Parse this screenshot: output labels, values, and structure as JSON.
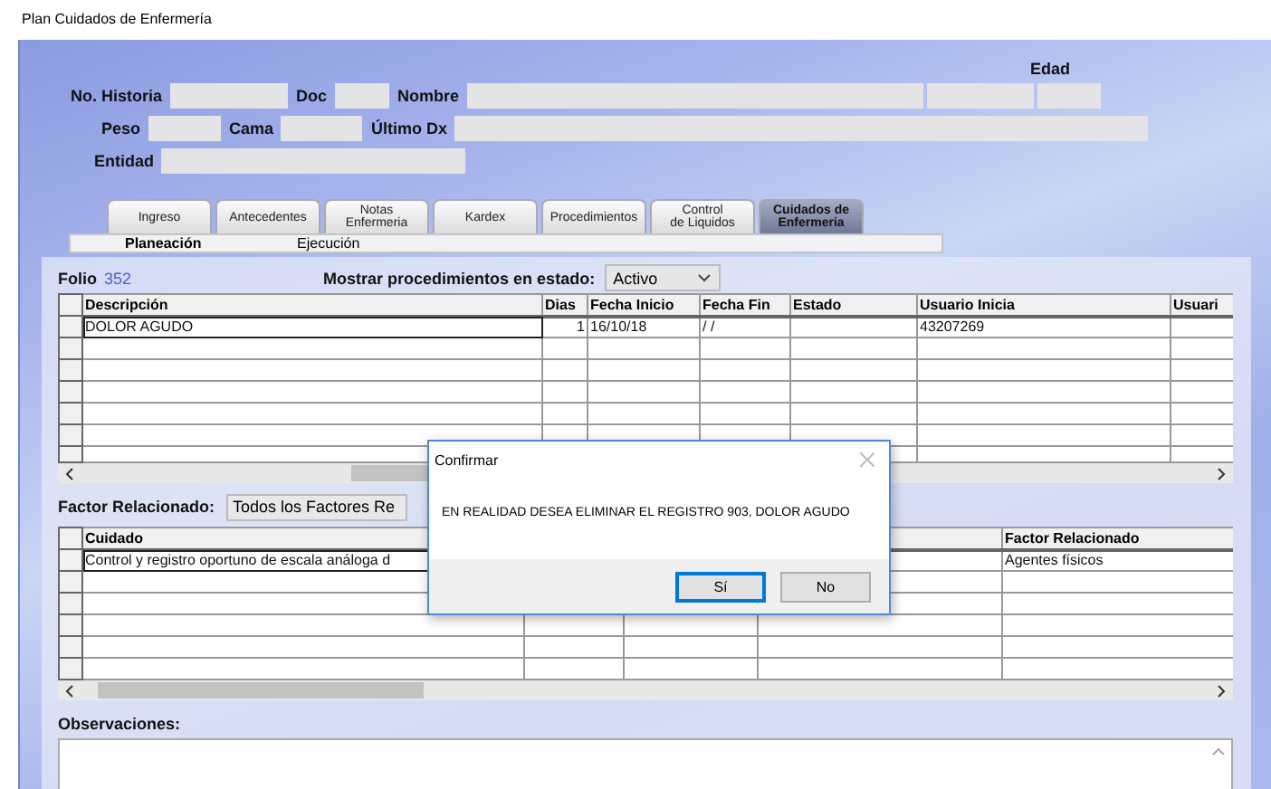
{
  "window": {
    "title": "Plan Cuidados de Enfermería"
  },
  "header": {
    "age_label": "Edad",
    "rows": [
      {
        "items": [
          {
            "kind": "label",
            "text": "No. Historia"
          },
          {
            "kind": "field"
          },
          {
            "kind": "label",
            "text": "Doc"
          },
          {
            "kind": "field"
          },
          {
            "kind": "label",
            "text": "Nombre"
          },
          {
            "kind": "field"
          },
          {
            "kind": "field"
          },
          {
            "kind": "field"
          }
        ]
      },
      {
        "items": [
          {
            "kind": "label",
            "text": "Peso"
          },
          {
            "kind": "field"
          },
          {
            "kind": "label",
            "text": "Cama"
          },
          {
            "kind": "field"
          },
          {
            "kind": "label",
            "text": "Último Dx"
          },
          {
            "kind": "field"
          }
        ]
      },
      {
        "items": [
          {
            "kind": "label",
            "text": "Entidad"
          },
          {
            "kind": "field"
          }
        ]
      }
    ]
  },
  "tabs": [
    {
      "label": "Ingreso",
      "selected": false
    },
    {
      "label": "Antecedentes",
      "selected": false
    },
    {
      "label": "Notas\nEnfermeria",
      "selected": false
    },
    {
      "label": "Kardex",
      "selected": false
    },
    {
      "label": "Procedimientos",
      "selected": false
    },
    {
      "label": "Control\nde Liquidos",
      "selected": false
    },
    {
      "label": "Cuidados de\nEnfermeria",
      "selected": true
    }
  ],
  "subtabs": [
    {
      "label": "Planeación",
      "selected": true
    },
    {
      "label": "Ejecución",
      "selected": false
    }
  ],
  "folio": {
    "label": "Folio",
    "value": "352"
  },
  "filter": {
    "label": "Mostrar procedimientos en estado:",
    "value": "Activo"
  },
  "procedures": {
    "columns": [
      "Descripción",
      "Dias",
      "Fecha Inicio",
      "Fecha Fin",
      "Estado",
      "Usuario Inicia",
      "Usuari"
    ],
    "rows": [
      [
        "DOLOR AGUDO",
        "1",
        "16/10/18",
        " /  /",
        null,
        "43207269",
        null
      ]
    ]
  },
  "factor": {
    "label": "Factor Relacionado:",
    "value": "Todos los Factores Re"
  },
  "cares": {
    "columns": [
      "Cuidado",
      null,
      null,
      null,
      "Factor Relacionado"
    ],
    "rows": [
      [
        "Control y registro oportuno de escala análoga d",
        null,
        null,
        null,
        "Agentes físicos"
      ]
    ]
  },
  "observations": {
    "label": "Observaciones:"
  },
  "dialog": {
    "title": "Confirmar",
    "message": "EN REALIDAD DESEA ELIMINAR EL REGISTRO 903, DOLOR AGUDO",
    "buttons": [
      {
        "label": "Sí",
        "selected": true
      },
      {
        "label": "No",
        "selected": false
      }
    ]
  }
}
